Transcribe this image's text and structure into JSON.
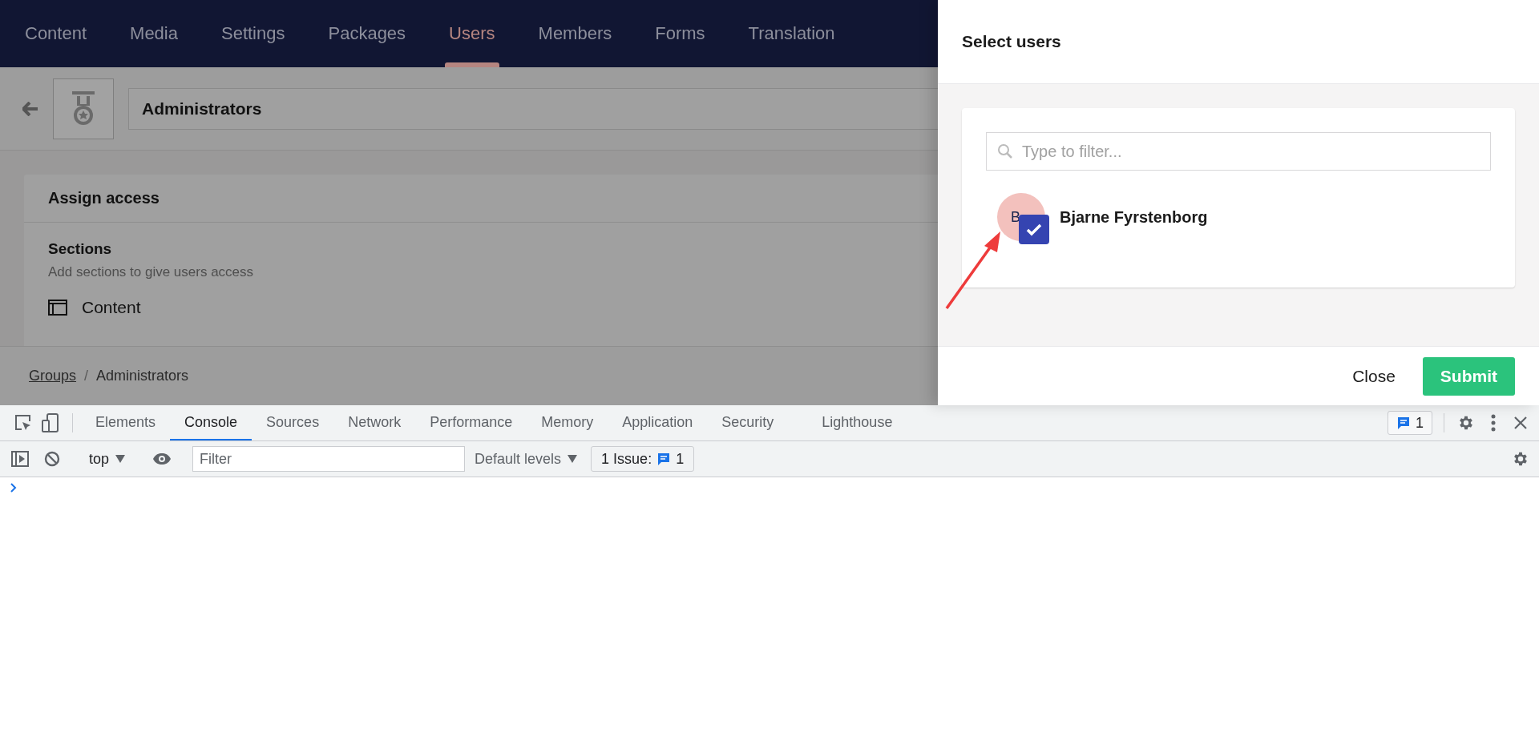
{
  "app": {
    "nav": [
      {
        "label": "Content",
        "selected": false
      },
      {
        "label": "Media",
        "selected": false
      },
      {
        "label": "Settings",
        "selected": false
      },
      {
        "label": "Packages",
        "selected": false
      },
      {
        "label": "Users",
        "selected": true
      },
      {
        "label": "Members",
        "selected": false
      },
      {
        "label": "Forms",
        "selected": false
      },
      {
        "label": "Translation",
        "selected": false
      }
    ],
    "group_name": "Administrators",
    "card": {
      "title": "Assign access",
      "section_title": "Sections",
      "section_hint": "Add sections to give users access",
      "sections": [
        {
          "label": "Content"
        }
      ]
    },
    "breadcrumb": {
      "items": [
        {
          "label": "Groups",
          "link": true
        },
        {
          "label": "Administrators",
          "link": false
        }
      ],
      "separator": "/"
    }
  },
  "dialog": {
    "title": "Select users",
    "filter": {
      "placeholder": "Type to filter..."
    },
    "users": [
      {
        "initials": "B",
        "name": "Bjarne Fyrstenborg",
        "selected": true
      }
    ],
    "buttons": [
      {
        "label": "Close",
        "kind": "link"
      },
      {
        "label": "Submit",
        "kind": "primary"
      }
    ]
  },
  "devtools": {
    "tabs": [
      {
        "label": "Elements",
        "selected": false
      },
      {
        "label": "Console",
        "selected": true
      },
      {
        "label": "Sources",
        "selected": false
      },
      {
        "label": "Network",
        "selected": false
      },
      {
        "label": "Performance",
        "selected": false
      },
      {
        "label": "Memory",
        "selected": false
      },
      {
        "label": "Application",
        "selected": false
      },
      {
        "label": "Security",
        "selected": false
      },
      {
        "label": "Lighthouse",
        "selected": false
      }
    ],
    "issues_badge": "1",
    "toolbar": {
      "context": "top",
      "filter": {
        "placeholder": "Filter"
      },
      "levels": "Default levels",
      "issues": {
        "label": "1 Issue:",
        "count": "1"
      }
    }
  }
}
